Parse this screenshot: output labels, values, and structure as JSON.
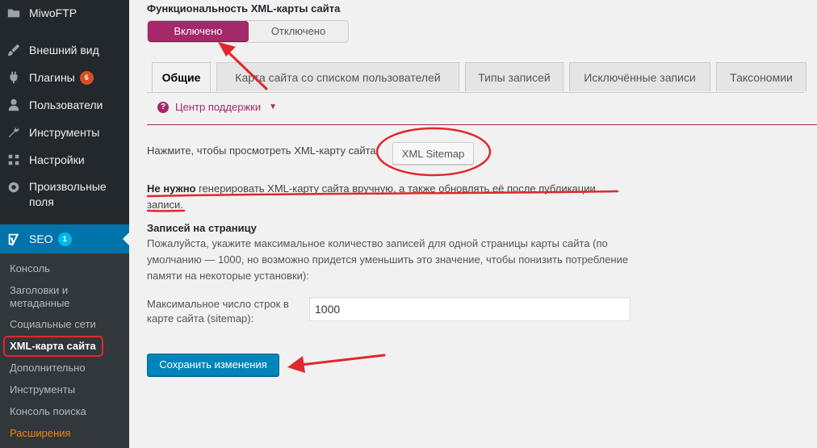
{
  "sidebar": {
    "items": [
      {
        "label": "MiwoFTP",
        "icon": "folder-icon"
      },
      {
        "label": "Внешний вид",
        "icon": "brush-icon"
      },
      {
        "label": "Плагины",
        "icon": "plugin-icon",
        "badge": "6"
      },
      {
        "label": "Пользователи",
        "icon": "users-icon"
      },
      {
        "label": "Инструменты",
        "icon": "wrench-icon"
      },
      {
        "label": "Настройки",
        "icon": "settings-icon"
      },
      {
        "label": "Произвольные поля",
        "icon": "gear-icon"
      }
    ],
    "seo": {
      "label": "SEO",
      "badge": "1",
      "icon": "yoast-icon"
    },
    "submenu": [
      "Консоль",
      "Заголовки и метаданные",
      "Социальные сети",
      "XML-карта сайта",
      "Дополнительно",
      "Инструменты",
      "Консоль поиска",
      "Расширения"
    ]
  },
  "toggle": {
    "title": "Функциональность XML-карты сайта",
    "on": "Включено",
    "off": "Отключено"
  },
  "tabs": [
    "Общие",
    "Карта сайта со списком пользователей",
    "Типы записей",
    "Исключённые записи",
    "Таксономии"
  ],
  "help": {
    "label": "Центр поддержки"
  },
  "main": {
    "view_label": "Нажмите, чтобы просмотреть XML-карту сайта:",
    "sitemap_button": "XML Sitemap",
    "note_bold": "Не нужно",
    "note_rest": " генерировать XML-карту сайта вручную, а также обновлять её после публикации записи.",
    "per_page_title": "Записей на страницу",
    "per_page_desc": "Пожалуйста, укажите максимальное количество записей для одной страницы карты сайта (по умолчанию — 1000, но возможно придется уменьшить это значение, чтобы понизить потребление памяти на некоторые установки):",
    "field_label": "Максимальное число строк в карте сайта (sitemap):",
    "field_value": "1000",
    "save_button": "Сохранить изменения"
  },
  "colors": {
    "admin_bar": "#23282d",
    "accent": "#a4286a",
    "primary": "#0085ba",
    "annotation": "#e0282c"
  }
}
